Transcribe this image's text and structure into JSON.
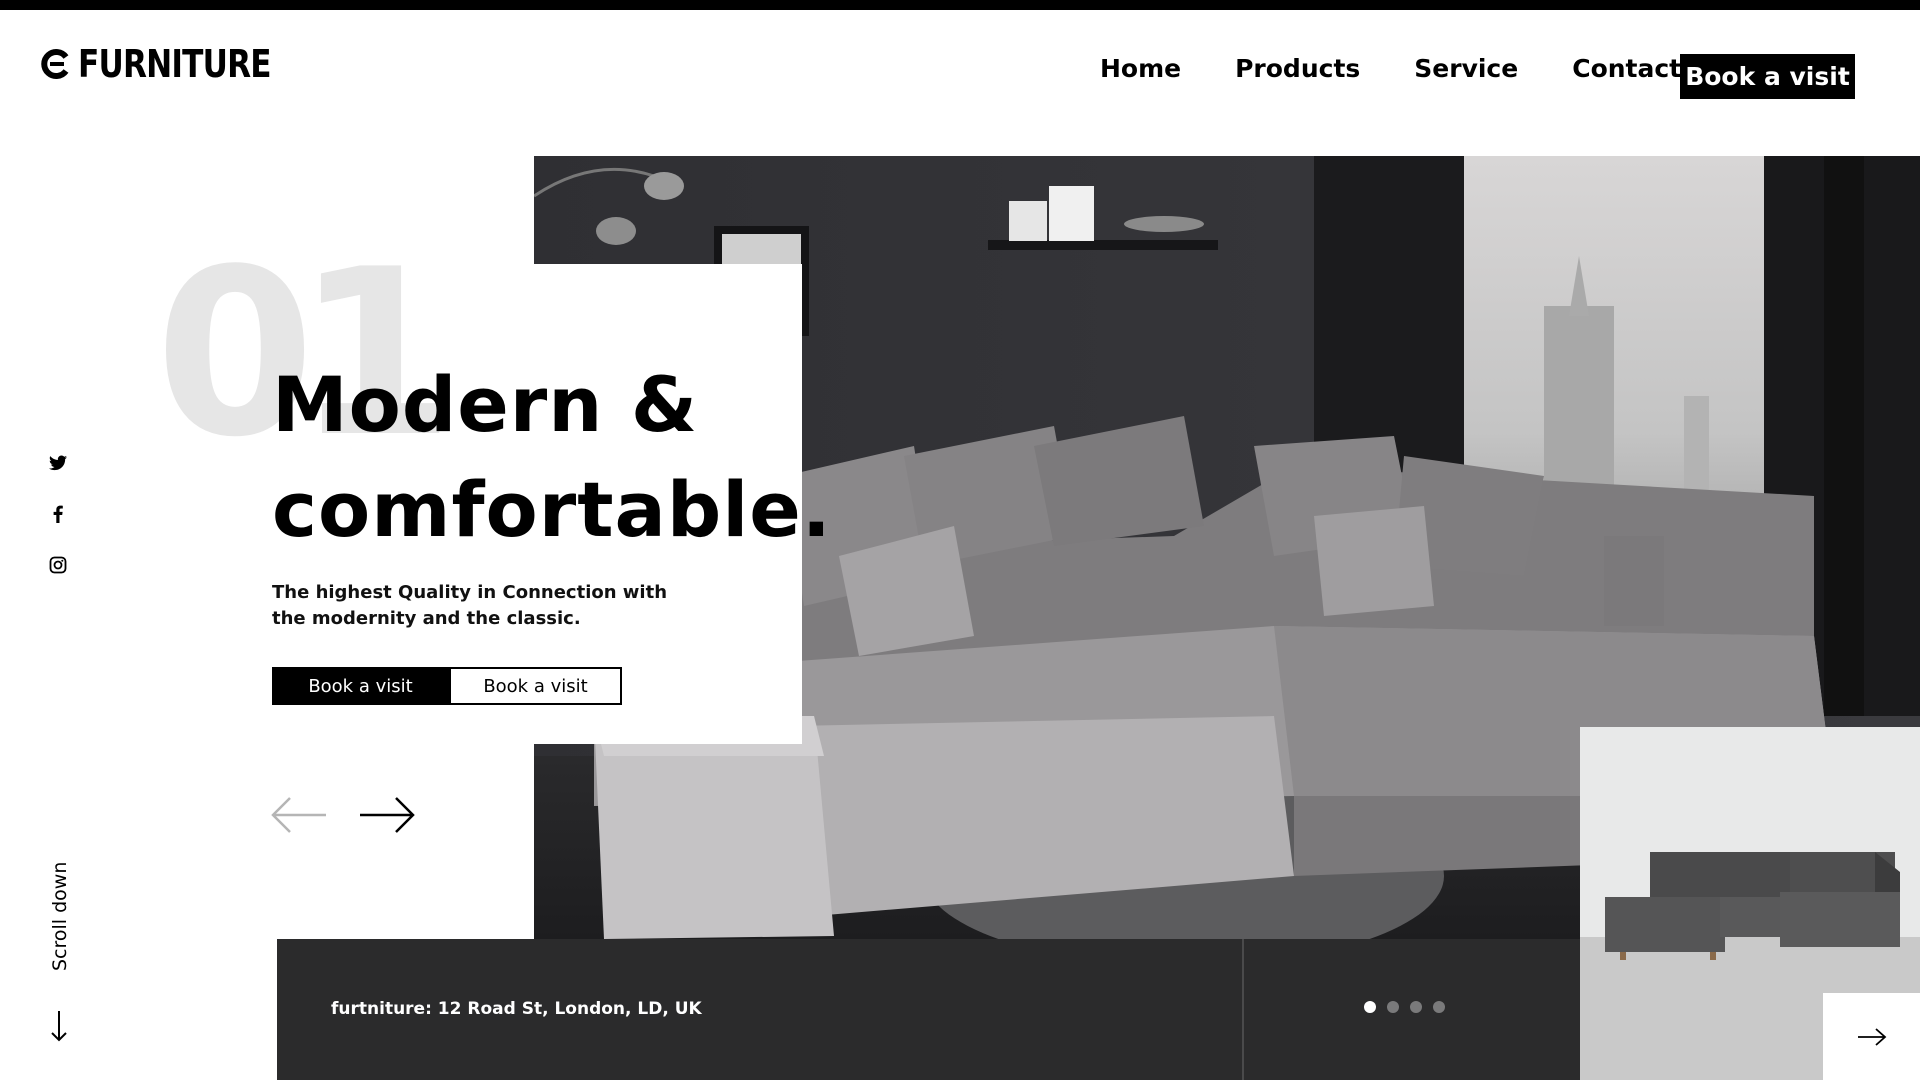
{
  "brand": {
    "name": "FURNITURE",
    "logo_icon": "c-logo-icon"
  },
  "nav": {
    "items": [
      {
        "label": "Home"
      },
      {
        "label": "Products"
      },
      {
        "label": "Service"
      },
      {
        "label": "Contact"
      }
    ],
    "cta_label": "Book a visit"
  },
  "hero": {
    "slide_number": "01",
    "headline_line1": "Modern &",
    "headline_line2": "comfortable.",
    "subtext": "The highest Quality in Connection with the modernity and the classic.",
    "primary_button": "Book a visit",
    "secondary_button": "Book a visit",
    "prev_icon": "arrow-left-icon",
    "next_icon": "arrow-right-icon"
  },
  "social": [
    "twitter-icon",
    "facebook-icon",
    "instagram-icon"
  ],
  "scroll": {
    "label": "Scroll down",
    "icon": "arrow-down-icon"
  },
  "footer": {
    "address": "furtniture: 12 Road St, London, LD, UK",
    "slides_total": 4,
    "active_slide": 1
  },
  "colors": {
    "accent": "#000000",
    "bar": "#2b2b2c",
    "bignum": "#e6e6e6"
  }
}
